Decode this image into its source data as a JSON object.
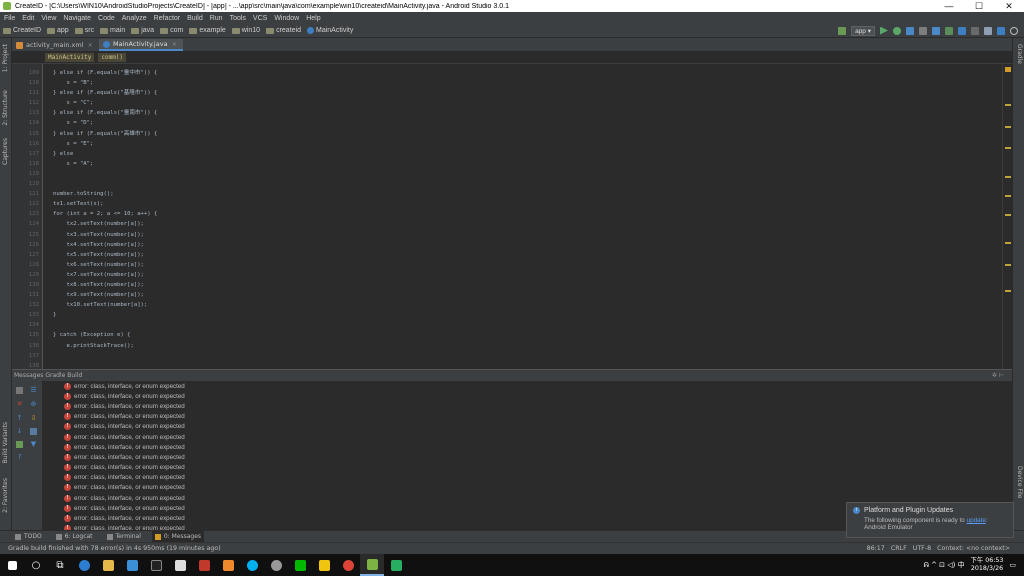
{
  "window": {
    "title": "CreateID - [C:\\Users\\WIN10\\AndroidStudioProjects\\CreateID] - [app] - ...\\app\\src\\main\\java\\com\\example\\win10\\createid\\MainActivity.java - Android Studio 3.0.1",
    "min": "—",
    "max": "☐",
    "close": "✕"
  },
  "menu": [
    "File",
    "Edit",
    "View",
    "Navigate",
    "Code",
    "Analyze",
    "Refactor",
    "Build",
    "Run",
    "Tools",
    "VCS",
    "Window",
    "Help"
  ],
  "breadcrumbs": [
    "CreateID",
    "app",
    "src",
    "main",
    "java",
    "com",
    "example",
    "win10",
    "createid",
    "MainActivity"
  ],
  "run_config": "app ▾",
  "left_tools": [
    "1: Project",
    "2: Structure",
    "Captures",
    "Build Variants",
    "2: Favorites"
  ],
  "right_tools": [
    "Gradle",
    "Device File"
  ],
  "editor_tabs": [
    {
      "label": "activity_main.xml",
      "close": "×"
    },
    {
      "label": "MainActivity.java",
      "close": "×"
    }
  ],
  "code_breadcrumbs": [
    "MainActivity",
    "comm()"
  ],
  "code_lines": [
    {
      "n": "109",
      "t": "} else if (F.equals(\"臺中市\")) {"
    },
    {
      "n": "110",
      "t": "    s = \"B\";"
    },
    {
      "n": "111",
      "t": "} else if (F.equals(\"基隆市\")) {"
    },
    {
      "n": "112",
      "t": "    s = \"C\";"
    },
    {
      "n": "113",
      "t": "} else if (F.equals(\"臺南市\")) {"
    },
    {
      "n": "114",
      "t": "    s = \"D\";"
    },
    {
      "n": "115",
      "t": "} else if (F.equals(\"高雄市\")) {"
    },
    {
      "n": "116",
      "t": "    s = \"E\";"
    },
    {
      "n": "117",
      "t": "} else"
    },
    {
      "n": "118",
      "t": "    s = \"A\";"
    },
    {
      "n": "119",
      "t": ""
    },
    {
      "n": "120",
      "t": ""
    },
    {
      "n": "121",
      "t": "number.toString();"
    },
    {
      "n": "122",
      "t": "tx1.setText(s);"
    },
    {
      "n": "123",
      "t": "for (int a = 2; a <= 10; a++) {"
    },
    {
      "n": "124",
      "t": "    tx2.setText(number[a]);"
    },
    {
      "n": "125",
      "t": "    tx3.setText(number[a]);"
    },
    {
      "n": "126",
      "t": "    tx4.setText(number[a]);"
    },
    {
      "n": "127",
      "t": "    tx5.setText(number[a]);"
    },
    {
      "n": "128",
      "t": "    tx6.setText(number[a]);"
    },
    {
      "n": "129",
      "t": "    tx7.setText(number[a]);"
    },
    {
      "n": "130",
      "t": "    tx8.setText(number[a]);"
    },
    {
      "n": "131",
      "t": "    tx9.setText(number[a]);"
    },
    {
      "n": "132",
      "t": "    tx10.setText(number[a]);"
    },
    {
      "n": "133",
      "t": "}"
    },
    {
      "n": "134",
      "t": ""
    },
    {
      "n": "135",
      "t": "} catch (Exception e) {"
    },
    {
      "n": "136",
      "t": "    e.printStackTrace();"
    },
    {
      "n": "137",
      "t": ""
    },
    {
      "n": "138",
      "t": ""
    }
  ],
  "messages_panel": {
    "header": "Messages Gradle Build",
    "gear": "✲ ⊢",
    "items": [
      "error: class, interface, or enum expected",
      "error: class, interface, or enum expected",
      "error: class, interface, or enum expected",
      "error: class, interface, or enum expected",
      "error: class, interface, or enum expected",
      "error: class, interface, or enum expected",
      "error: class, interface, or enum expected",
      "error: class, interface, or enum expected",
      "error: class, interface, or enum expected",
      "error: class, interface, or enum expected",
      "error: class, interface, or enum expected",
      "error: class, interface, or enum expected",
      "error: class, interface, or enum expected",
      "error: class, interface, or enum expected",
      "error: class, interface, or enum expected"
    ]
  },
  "tool_windows": [
    "TODO",
    "6: Logcat",
    "Terminal",
    "0: Messages"
  ],
  "status": {
    "text": "Gradle build finished with 78 error(s) in 4s 950ms (19 minutes ago)",
    "position": "86:17",
    "line_sep": "CRLF",
    "encoding": "UTF-8",
    "context": "Context: <no context>"
  },
  "notification": {
    "title": "Platform and Plugin Updates",
    "body_prefix": "The following component is ready to",
    "link": "update",
    "body_suffix": ":",
    "body_line2": "Android Emulator"
  },
  "taskbar": {
    "tray": "ᕱ ^ ⊡ ◁) 中",
    "time": "下午 06:53",
    "date": "2018/3/26"
  }
}
